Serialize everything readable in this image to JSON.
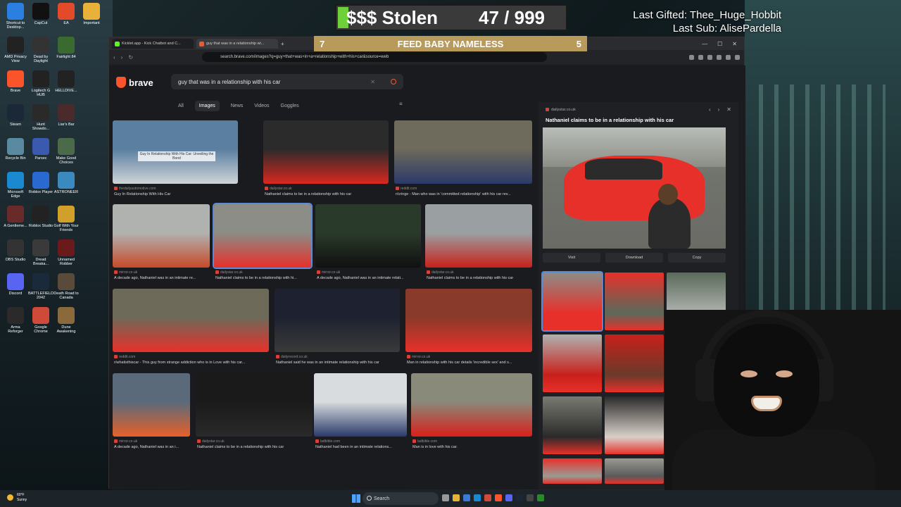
{
  "stream": {
    "stolen_label": "$$$ Stolen",
    "stolen_count": "47 / 999",
    "stolen_progress": 0.047,
    "last_gifted": "Last Gifted: Thee_Huge_Hobbit",
    "last_sub": "Last Sub: AlisePardella",
    "feed_left": "7",
    "feed_text": "FEED BABY NAMELESS",
    "feed_right": "5"
  },
  "desktop": {
    "icons": [
      {
        "label": "Shortcut to Desktop...",
        "color": "#2a7fe0"
      },
      {
        "label": "CapCut",
        "color": "#111111"
      },
      {
        "label": "EA",
        "color": "#e24a2a"
      },
      {
        "label": "Important",
        "color": "#e8b23a"
      },
      {
        "label": "AMD Privacy View",
        "color": "#222222"
      },
      {
        "label": "Dead by Daylight",
        "color": "#333333"
      },
      {
        "label": "Fairlight 84",
        "color": "#3a6a30"
      },
      {
        "label": "Brave",
        "color": "#fb542b"
      },
      {
        "label": "Logitech G HUB",
        "color": "#222222"
      },
      {
        "label": "HELLDIVE...",
        "color": "#222222"
      },
      {
        "label": "Steam",
        "color": "#1b2838"
      },
      {
        "label": "Hunt Showdo...",
        "color": "#2a2a2a"
      },
      {
        "label": "Liar's Bar",
        "color": "#4a2a2a"
      },
      {
        "label": "Recycle Bin",
        "color": "#5a8aa0"
      },
      {
        "label": "Parsec",
        "color": "#3a5ab0"
      },
      {
        "label": "Make Good Choices",
        "color": "#4a6a4a"
      },
      {
        "label": "Microsoft Edge",
        "color": "#1a8ad0"
      },
      {
        "label": "Roblox Player",
        "color": "#2a6ad0"
      },
      {
        "label": "ASTRONEER",
        "color": "#3a8ac0"
      },
      {
        "label": "A Gentleme...",
        "color": "#6a2a2a"
      },
      {
        "label": "Roblox Studio",
        "color": "#222222"
      },
      {
        "label": "Golf With Your Friends",
        "color": "#d0a02a"
      },
      {
        "label": "OBS Studio",
        "color": "#333333"
      },
      {
        "label": "Dread Breaka...",
        "color": "#3a3a3a"
      },
      {
        "label": "Unnamed Robber",
        "color": "#6a1a1a"
      },
      {
        "label": "Discord",
        "color": "#5865f2"
      },
      {
        "label": "BATTLEFIELD 2042",
        "color": "#1a2a3a"
      },
      {
        "label": "Death Road to Canada",
        "color": "#5a4a3a"
      },
      {
        "label": "Arma Reforger",
        "color": "#2a2a2a"
      },
      {
        "label": "Google Chrome",
        "color": "#d04a3a"
      },
      {
        "label": "Dune Awakening",
        "color": "#8a6a3a"
      }
    ]
  },
  "browser": {
    "tabs": [
      {
        "label": "Kicklet.app - Kick Chatbot and C..."
      },
      {
        "label": "guy that was in a relationship wi..."
      }
    ],
    "url": "search.brave.com/images?q=guy+that+was+in+a+relationship+with+his+car&source=web",
    "brand": "brave",
    "query": "guy that was in a relationship with his car",
    "search_tabs": [
      "All",
      "Images",
      "News",
      "Videos",
      "Goggles"
    ],
    "active_tab": "Images"
  },
  "results": [
    {
      "source": "thedailyautomotive.com",
      "caption": "Guy In Relationship With His Car",
      "overlay": "Guy In Relationship With His Car: Unveiling the Bond"
    },
    {
      "source": "dailystar.co.uk",
      "caption": "Nathaniel claims to be in a relationship with his car"
    },
    {
      "source": "reddit.com",
      "caption": "r/cringe - Man who was in 'committed relationship' with his car rev..."
    },
    {
      "source": "mirror.co.uk",
      "caption": "A decade ago, Nathaniel was in an intimate re..."
    },
    {
      "source": "dailystar.co.uk",
      "caption": "Nathaniel claims to be in a relationship with hi..."
    },
    {
      "source": "mirror.co.uk",
      "caption": "A decade ago, Nathaniel was in an intimate relati..."
    },
    {
      "source": "dailystar.co.uk",
      "caption": "Nathaniel claims to be in a relationship with his car"
    },
    {
      "source": "reddit.com",
      "caption": "r/whatisthiscar - This guy from strange addiction who is in Love with his car..."
    },
    {
      "source": "dailyrecord.co.uk",
      "caption": "Nathaniel said he was in an intimate relationship with his car"
    },
    {
      "source": "mirror.co.uk",
      "caption": "Man in relationship with his car details 'incredible sex' and s..."
    },
    {
      "source": "mirror.co.uk",
      "caption": "A decade ago, Nathaniel was in an i..."
    },
    {
      "source": "dailystar.co.uk",
      "caption": "Nathaniel claims to be in a relationship with his car"
    },
    {
      "source": "ladbible.com",
      "caption": "Nathaniel had been in an intimate relations..."
    },
    {
      "source": "ladbible.com",
      "caption": "Man is in love with his car."
    }
  ],
  "panel": {
    "source": "dailystar.co.uk",
    "title": "Nathaniel claims to be in a relationship with his car",
    "visit": "Visit",
    "download": "Download",
    "copy": "Copy"
  },
  "taskbar": {
    "temp": "60°F",
    "weather": "Sunny",
    "search": "Search"
  }
}
